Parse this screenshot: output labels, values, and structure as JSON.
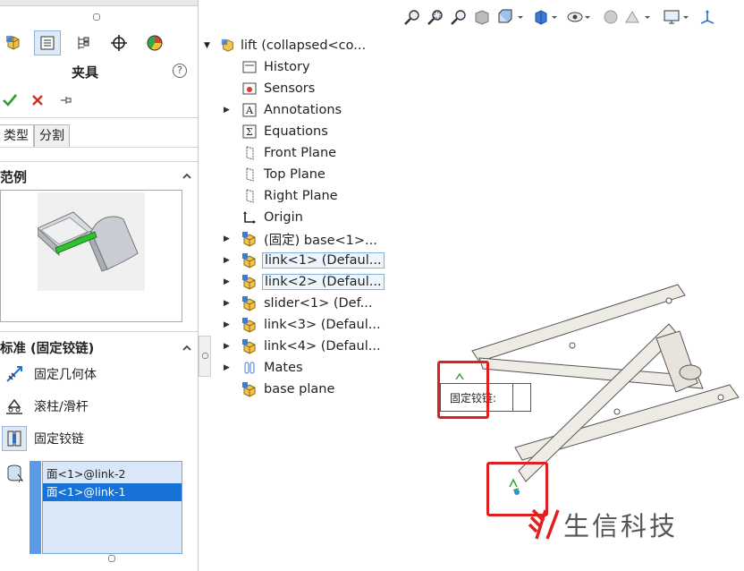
{
  "property_manager": {
    "title": "夹具",
    "help": "?",
    "tabs": [
      "类型",
      "分割"
    ],
    "sample_section": {
      "title": "范例"
    },
    "standard_section": {
      "title": "标准 (固定铰链)",
      "types": [
        {
          "label": "固定几何体",
          "icon": "fixed-geometry-icon"
        },
        {
          "label": "滚柱/滑杆",
          "icon": "roller-slider-icon"
        },
        {
          "label": "固定铰链",
          "icon": "fixed-hinge-icon"
        }
      ]
    },
    "selections": [
      "面<1>@link-2",
      "面<1>@link-1"
    ]
  },
  "tree": {
    "root": "lift  (collapsed<co...",
    "items": [
      {
        "label": "History",
        "icon": "history-icon",
        "expandable": false
      },
      {
        "label": "Sensors",
        "icon": "sensors-icon",
        "expandable": false
      },
      {
        "label": "Annotations",
        "icon": "annotations-icon",
        "expandable": true
      },
      {
        "label": "Equations",
        "icon": "equations-icon",
        "expandable": false
      },
      {
        "label": "Front Plane",
        "icon": "plane-icon",
        "expandable": false
      },
      {
        "label": "Top Plane",
        "icon": "plane-icon",
        "expandable": false
      },
      {
        "label": "Right Plane",
        "icon": "plane-icon",
        "expandable": false
      },
      {
        "label": "Origin",
        "icon": "origin-icon",
        "expandable": false
      },
      {
        "label": "(固定) base<1>...",
        "icon": "part-icon",
        "expandable": true
      },
      {
        "label": "link<1> (Defaul...",
        "icon": "part-icon",
        "expandable": true
      },
      {
        "label": "link<2> (Defaul...",
        "icon": "part-icon",
        "expandable": true
      },
      {
        "label": "slider<1> (Def...",
        "icon": "part-icon",
        "expandable": true
      },
      {
        "label": "link<3> (Defaul...",
        "icon": "part-icon",
        "expandable": true
      },
      {
        "label": "link<4> (Defaul...",
        "icon": "part-icon",
        "expandable": true
      },
      {
        "label": "Mates",
        "icon": "mates-icon",
        "expandable": true
      },
      {
        "label": "base plane",
        "icon": "part-icon",
        "expandable": false
      }
    ]
  },
  "viewport": {
    "hinge_label": "固定铰链:",
    "watermark": "生信科技"
  },
  "colors": {
    "accent": "#1672d6",
    "callout": "#e02020",
    "watermark": "#e02020"
  }
}
